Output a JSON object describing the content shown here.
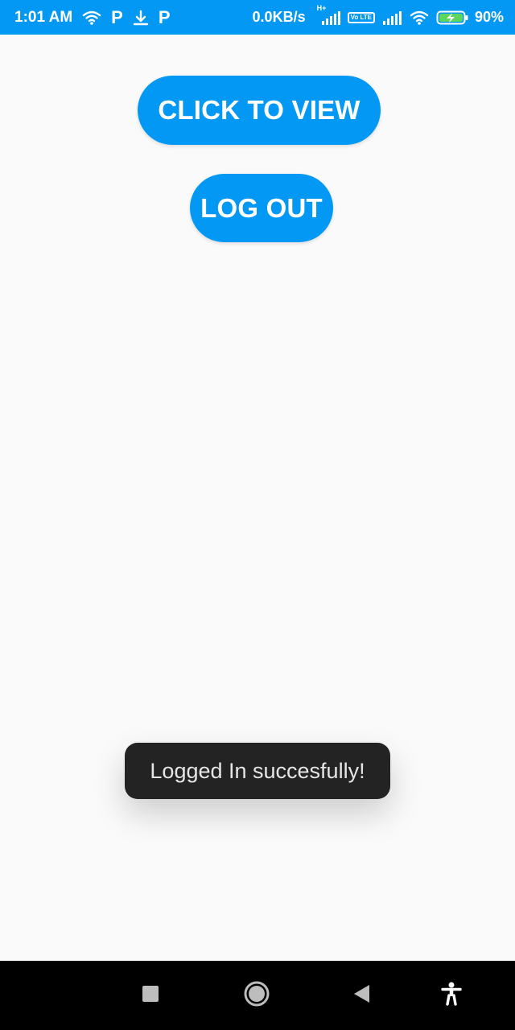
{
  "status_bar": {
    "time": "1:01 AM",
    "net_speed": "0.0KB/s",
    "network_type": "H+",
    "volte": "Vo LTE",
    "battery_percent": "90%",
    "left_icons": [
      "wifi-icon",
      "p-app-icon",
      "download-icon",
      "p-app-icon"
    ],
    "right_icons": [
      "signal-icon",
      "signal-icon",
      "wifi-icon",
      "battery-charging-icon"
    ],
    "p_app_letter": "P"
  },
  "buttons": {
    "click_to_view": "CLICK TO VIEW",
    "log_out": "LOG OUT"
  },
  "toast": {
    "message": "Logged In succesfully!"
  },
  "nav_bar": {
    "icons": [
      "recents-icon",
      "home-icon",
      "back-icon",
      "accessibility-icon"
    ]
  },
  "colors": {
    "accent": "#0498f5",
    "background": "#fafafa",
    "toast_bg": "#232323",
    "nav_bg": "#000000"
  }
}
